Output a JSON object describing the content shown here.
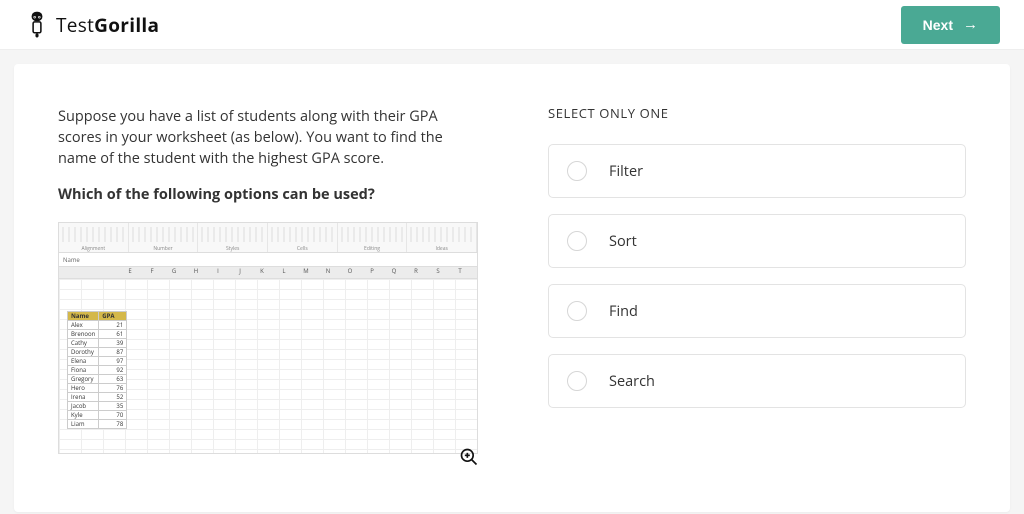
{
  "header": {
    "brand_light": "Test",
    "brand_bold": "Gorilla",
    "next_label": "Next"
  },
  "question": {
    "prompt": "Suppose you have a list of students along with their GPA scores in your worksheet (as below). You want to find the name of the student with the highest GPA score.",
    "bold": "Which of the following options can be used?",
    "name_box": "Name",
    "ribbon_groups": [
      "Alignment",
      "Number",
      "Styles",
      "Cells",
      "Editing",
      "Ideas"
    ],
    "col_letters": [
      "E",
      "F",
      "G",
      "H",
      "I",
      "J",
      "K",
      "L",
      "M",
      "N",
      "O",
      "P",
      "Q",
      "R",
      "S",
      "T"
    ],
    "table_header": [
      "Name",
      "GPA"
    ],
    "students": [
      {
        "name": "Alex",
        "gpa": 21
      },
      {
        "name": "Brenoon",
        "gpa": 61
      },
      {
        "name": "Cathy",
        "gpa": 39
      },
      {
        "name": "Dorothy",
        "gpa": 87
      },
      {
        "name": "Elena",
        "gpa": 97
      },
      {
        "name": "Fiona",
        "gpa": 92
      },
      {
        "name": "Gregory",
        "gpa": 63
      },
      {
        "name": "Hero",
        "gpa": 76
      },
      {
        "name": "Irena",
        "gpa": 52
      },
      {
        "name": "Jacob",
        "gpa": 35
      },
      {
        "name": "Kyle",
        "gpa": 70
      },
      {
        "name": "Liam",
        "gpa": 78
      }
    ]
  },
  "answers": {
    "instruction": "SELECT ONLY ONE",
    "options": [
      "Filter",
      "Sort",
      "Find",
      "Search"
    ]
  }
}
